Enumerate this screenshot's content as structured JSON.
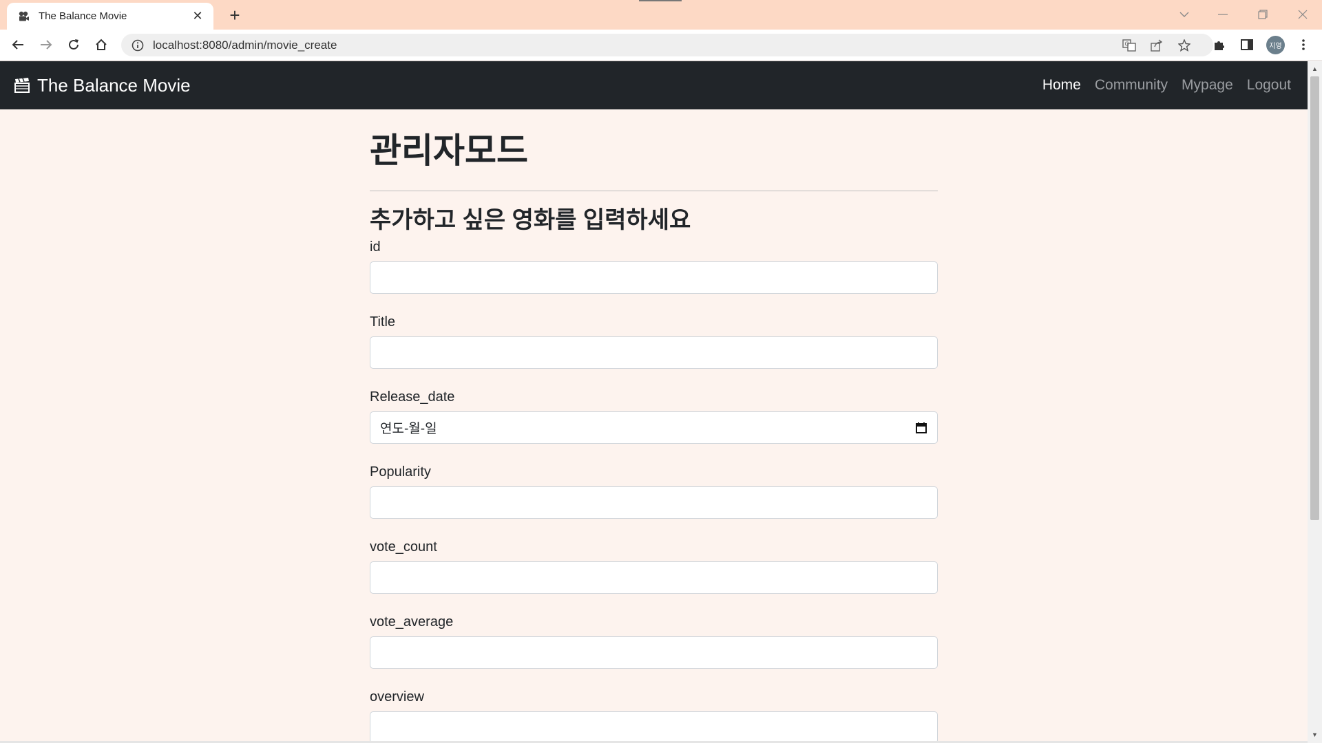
{
  "browser": {
    "tab_title": "The Balance Movie",
    "new_tab_symbol": "+",
    "url": "localhost:8080/admin/movie_create",
    "avatar_text": "지영"
  },
  "navbar": {
    "brand": "The Balance Movie",
    "links": [
      {
        "label": "Home"
      },
      {
        "label": "Community"
      },
      {
        "label": "Mypage"
      },
      {
        "label": "Logout"
      }
    ]
  },
  "page": {
    "title": "관리자모드",
    "subtitle": "추가하고 싶은 영화를 입력하세요"
  },
  "form": {
    "fields": [
      {
        "label": "id",
        "value": ""
      },
      {
        "label": "Title",
        "value": ""
      },
      {
        "label": "Release_date",
        "value": "연도-월-일"
      },
      {
        "label": "Popularity",
        "value": ""
      },
      {
        "label": "vote_count",
        "value": ""
      },
      {
        "label": "vote_average",
        "value": ""
      },
      {
        "label": "overview",
        "value": ""
      }
    ]
  },
  "colors": {
    "tabstrip": "#fdd9c5",
    "navbar": "#212529",
    "page_bg": "#fdf3ee"
  }
}
